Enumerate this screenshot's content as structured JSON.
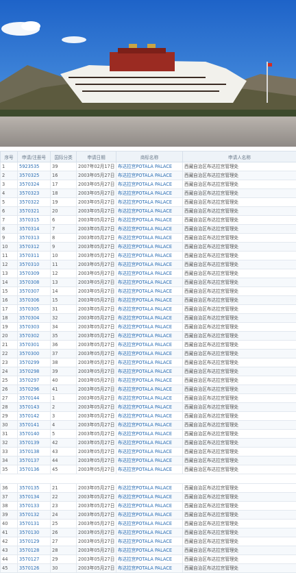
{
  "hero": {
    "image_alt": "Potala Palace photo",
    "flag_color": "#d62a1e",
    "sky_color": "#2f7fd6"
  },
  "table": {
    "headers": [
      "序号",
      "申请/注册号",
      "国际分类",
      "申请日期",
      "商标名称",
      "申请人名称"
    ],
    "rows_part1": [
      [
        "1",
        "5923535",
        "39",
        "2007年02月17日",
        "布达拉宫POTALA PALACE",
        "西藏自治区布达拉宫管理处"
      ],
      [
        "2",
        "3570325",
        "16",
        "2003年05月27日",
        "布达拉宫POTALA PALACE",
        "西藏自治区布达拉宫管理处"
      ],
      [
        "3",
        "3570324",
        "17",
        "2003年05月27日",
        "布达拉宫POTALA PALACE",
        "西藏自治区布达拉宫管理处"
      ],
      [
        "4",
        "3570323",
        "18",
        "2003年05月27日",
        "布达拉宫POTALA PALACE",
        "西藏自治区布达拉宫管理处"
      ],
      [
        "5",
        "3570322",
        "19",
        "2003年05月27日",
        "布达拉宫POTALA PALACE",
        "西藏自治区布达拉宫管理处"
      ],
      [
        "6",
        "3570321",
        "20",
        "2003年05月27日",
        "布达拉宫POTALA PALACE",
        "西藏自治区布达拉宫管理处"
      ],
      [
        "7",
        "3570315",
        "6",
        "2003年05月27日",
        "布达拉宫POTALA PALACE",
        "西藏自治区布达拉宫管理处"
      ],
      [
        "8",
        "3570314",
        "7",
        "2003年05月27日",
        "布达拉宫POTALA PALACE",
        "西藏自治区布达拉宫管理处"
      ],
      [
        "9",
        "3570313",
        "8",
        "2003年05月27日",
        "布达拉宫POTALA PALACE",
        "西藏自治区布达拉宫管理处"
      ],
      [
        "10",
        "3570312",
        "9",
        "2003年05月27日",
        "布达拉宫POTALA PALACE",
        "西藏自治区布达拉宫管理处"
      ],
      [
        "11",
        "3570311",
        "10",
        "2003年05月27日",
        "布达拉宫POTALA PALACE",
        "西藏自治区布达拉宫管理处"
      ],
      [
        "12",
        "3570310",
        "11",
        "2003年05月27日",
        "布达拉宫POTALA PALACE",
        "西藏自治区布达拉宫管理处"
      ],
      [
        "13",
        "3570309",
        "12",
        "2003年05月27日",
        "布达拉宫POTALA PALACE",
        "西藏自治区布达拉宫管理处"
      ],
      [
        "14",
        "3570308",
        "13",
        "2003年05月27日",
        "布达拉宫POTALA PALACE",
        "西藏自治区布达拉宫管理处"
      ],
      [
        "15",
        "3570307",
        "14",
        "2003年05月27日",
        "布达拉宫POTALA PALACE",
        "西藏自治区布达拉宫管理处"
      ],
      [
        "16",
        "3570306",
        "15",
        "2003年05月27日",
        "布达拉宫POTALA PALACE",
        "西藏自治区布达拉宫管理处"
      ],
      [
        "17",
        "3570305",
        "31",
        "2003年05月27日",
        "布达拉宫POTALA PALACE",
        "西藏自治区布达拉宫管理处"
      ],
      [
        "18",
        "3570304",
        "32",
        "2003年05月27日",
        "布达拉宫POTALA PALACE",
        "西藏自治区布达拉宫管理处"
      ],
      [
        "19",
        "3570303",
        "34",
        "2003年05月27日",
        "布达拉宫POTALA PALACE",
        "西藏自治区布达拉宫管理处"
      ],
      [
        "20",
        "3570302",
        "35",
        "2003年05月27日",
        "布达拉宫POTALA PALACE",
        "西藏自治区布达拉宫管理处"
      ],
      [
        "21",
        "3570301",
        "36",
        "2003年05月27日",
        "布达拉宫POTALA PALACE",
        "西藏自治区布达拉宫管理处"
      ],
      [
        "22",
        "3570300",
        "37",
        "2003年05月27日",
        "布达拉宫POTALA PALACE",
        "西藏自治区布达拉宫管理处"
      ],
      [
        "23",
        "3570299",
        "38",
        "2003年05月27日",
        "布达拉宫POTALA PALACE",
        "西藏自治区布达拉宫管理处"
      ],
      [
        "24",
        "3570298",
        "39",
        "2003年05月27日",
        "布达拉宫POTALA PALACE",
        "西藏自治区布达拉宫管理处"
      ],
      [
        "25",
        "3570297",
        "40",
        "2003年05月27日",
        "布达拉宫POTALA PALACE",
        "西藏自治区布达拉宫管理处"
      ],
      [
        "26",
        "3570296",
        "41",
        "2003年05月27日",
        "布达拉宫POTALA PALACE",
        "西藏自治区布达拉宫管理处"
      ],
      [
        "27",
        "3570144",
        "1",
        "2003年05月27日",
        "布达拉宫POTALA PALACE",
        "西藏自治区布达拉宫管理处"
      ],
      [
        "28",
        "3570143",
        "2",
        "2003年05月27日",
        "布达拉宫POTALA PALACE",
        "西藏自治区布达拉宫管理处"
      ],
      [
        "29",
        "3570142",
        "3",
        "2003年05月27日",
        "布达拉宫POTALA PALACE",
        "西藏自治区布达拉宫管理处"
      ],
      [
        "30",
        "3570141",
        "4",
        "2003年05月27日",
        "布达拉宫POTALA PALACE",
        "西藏自治区布达拉宫管理处"
      ],
      [
        "31",
        "3570140",
        "5",
        "2003年05月27日",
        "布达拉宫POTALA PALACE",
        "西藏自治区布达拉宫管理处"
      ],
      [
        "32",
        "3570139",
        "42",
        "2003年05月27日",
        "布达拉宫POTALA PALACE",
        "西藏自治区布达拉宫管理处"
      ],
      [
        "33",
        "3570138",
        "43",
        "2003年05月27日",
        "布达拉宫POTALA PALACE",
        "西藏自治区布达拉宫管理处"
      ],
      [
        "34",
        "3570137",
        "44",
        "2003年05月27日",
        "布达拉宫POTALA PALACE",
        "西藏自治区布达拉宫管理处"
      ],
      [
        "35",
        "3570136",
        "45",
        "2003年05月27日",
        "布达拉宫POTALA PALACE",
        "西藏自治区布达拉宫管理处"
      ]
    ],
    "rows_part2": [
      [
        "36",
        "3570135",
        "21",
        "2003年05月27日",
        "布达拉宫POTALA PALACE",
        "西藏自治区布达拉宫管理处"
      ],
      [
        "37",
        "3570134",
        "22",
        "2003年05月27日",
        "布达拉宫POTALA PALACE",
        "西藏自治区布达拉宫管理处"
      ],
      [
        "38",
        "3570133",
        "23",
        "2003年05月27日",
        "布达拉宫POTALA PALACE",
        "西藏自治区布达拉宫管理处"
      ],
      [
        "39",
        "3570132",
        "24",
        "2003年05月27日",
        "布达拉宫POTALA PALACE",
        "西藏自治区布达拉宫管理处"
      ],
      [
        "40",
        "3570131",
        "25",
        "2003年05月27日",
        "布达拉宫POTALA PALACE",
        "西藏自治区布达拉宫管理处"
      ],
      [
        "41",
        "3570130",
        "26",
        "2003年05月27日",
        "布达拉宫POTALA PALACE",
        "西藏自治区布达拉宫管理处"
      ],
      [
        "42",
        "3570129",
        "27",
        "2003年05月27日",
        "布达拉宫POTALA PALACE",
        "西藏自治区布达拉宫管理处"
      ],
      [
        "43",
        "3570128",
        "28",
        "2003年05月27日",
        "布达拉宫POTALA PALACE",
        "西藏自治区布达拉宫管理处"
      ],
      [
        "44",
        "3570127",
        "29",
        "2003年05月27日",
        "布达拉宫POTALA PALACE",
        "西藏自治区布达拉宫管理处"
      ],
      [
        "45",
        "3570126",
        "30",
        "2003年05月27日",
        "布达拉宫POTALA PALACE",
        "西藏自治区布达拉宫管理处"
      ]
    ]
  }
}
